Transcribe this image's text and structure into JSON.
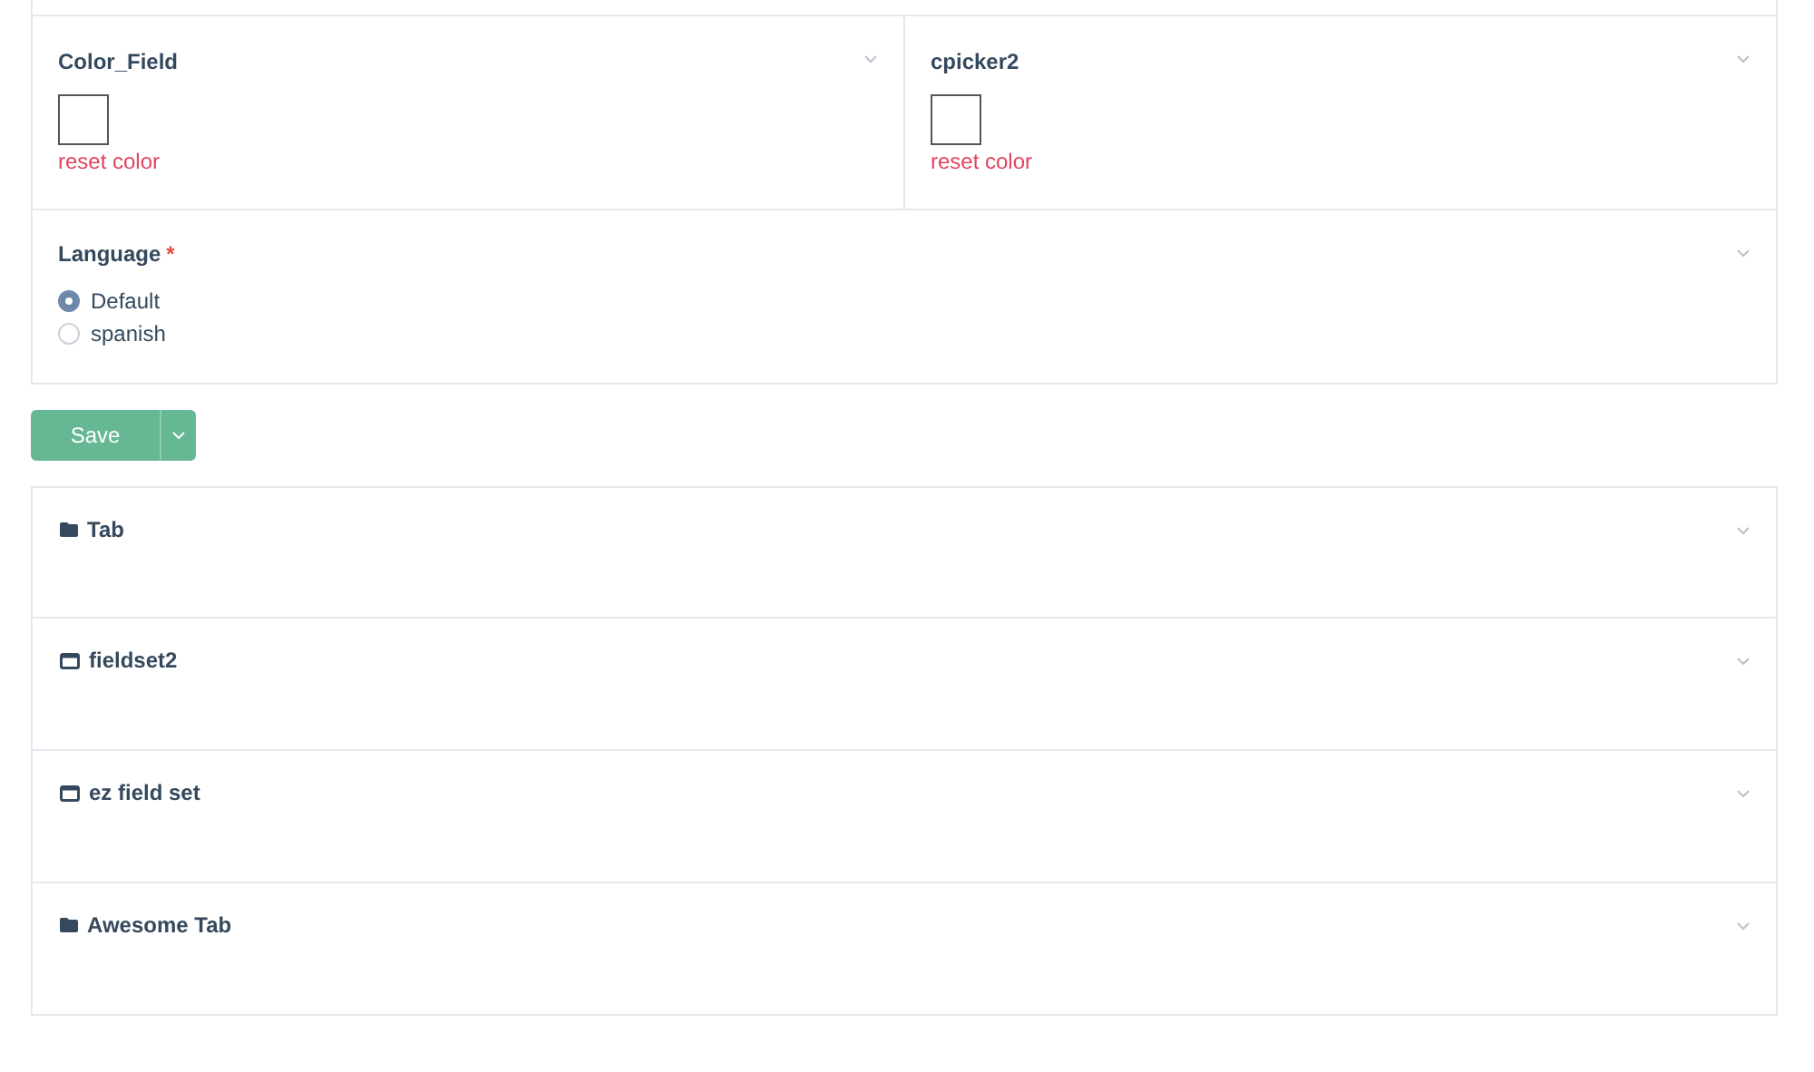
{
  "color_fields": [
    {
      "label": "Color_Field",
      "reset": "reset color"
    },
    {
      "label": "cpicker2",
      "reset": "reset color"
    }
  ],
  "language": {
    "label": "Language",
    "required_mark": "*",
    "options": [
      {
        "label": "Default",
        "selected": true
      },
      {
        "label": "spanish",
        "selected": false
      }
    ]
  },
  "save_button": {
    "label": "Save"
  },
  "sections": [
    {
      "kind": "tab",
      "title": "Tab"
    },
    {
      "kind": "fieldset",
      "title": "fieldset2"
    },
    {
      "kind": "fieldset",
      "title": "ez field set"
    },
    {
      "kind": "tab",
      "title": "Awesome Tab"
    }
  ]
}
